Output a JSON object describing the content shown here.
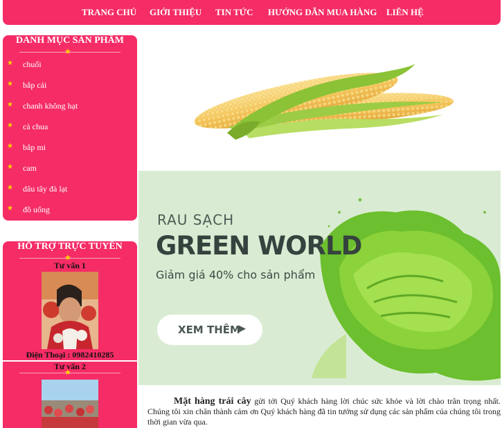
{
  "nav": [
    "TRANG CHỦ",
    "GIỚI THIỆU",
    "TIN TỨC",
    "HƯỚNG DẪN MUA HÀNG",
    "LIÊN HỆ"
  ],
  "categories": {
    "title": "DANH MỤC SẢN PHẨM",
    "items": [
      "chuối",
      "bắp cải",
      "chanh không hạt",
      "cà chua",
      "bắp mi",
      "cam",
      "dâu tây đà lạt",
      "đồ uống"
    ]
  },
  "support": {
    "title": "HỖ TRỢ TRỰC TUYẾN",
    "advisors": [
      {
        "name": "Tư vấn 1",
        "phone": "Điện Thoại : 0982410285"
      },
      {
        "name": "Tư vấn 2"
      }
    ]
  },
  "banner": {
    "title_small": "RAU SẠCH",
    "title_big": "GREEN WORLD",
    "discount": "Giảm giá 40% cho sản phẩm",
    "button": "XEM THÊM"
  },
  "intro": {
    "bold": "Mặt hàng trái cây",
    "text": " gửi tới Quý khách hàng lời chúc sức khỏe và lời chào trân trọng nhất. Chúng tôi xin chân thành cảm ơn Quý khách hàng đã tin tưởng sử dụng các sản phẩm của chúng tôi trong thời gian vừa qua."
  },
  "colors": {
    "accent": "#f52c66",
    "star": "#ffd700",
    "banner_bg": "#d9ecd3"
  }
}
